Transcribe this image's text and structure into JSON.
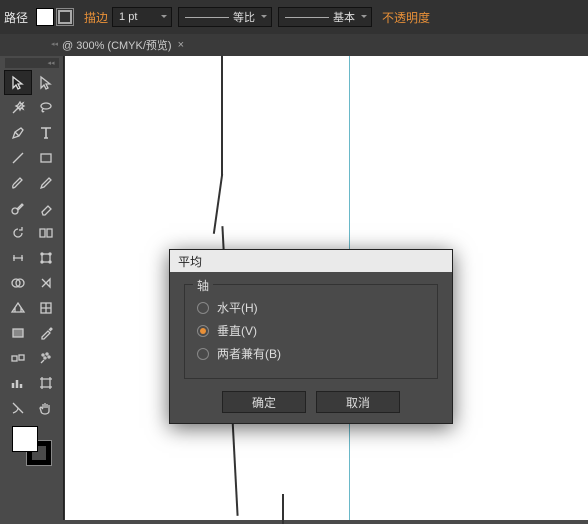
{
  "topbar": {
    "label": "路径",
    "stroke_label": "描边",
    "weight": "1 pt",
    "dash_label": "等比",
    "brush_label": "基本",
    "opacity_label": "不透明度"
  },
  "tab": {
    "title": "@ 300% (CMYK/预览)",
    "close": "×"
  },
  "dialog": {
    "title": "平均",
    "group_label": "轴",
    "options": {
      "h": "水平(H)",
      "v": "垂直(V)",
      "b": "两者兼有(B)"
    },
    "ok": "确定",
    "cancel": "取消"
  },
  "tools": {
    "selection": "selection",
    "direct": "direct-select",
    "wand": "magic-wand",
    "lasso": "lasso",
    "pen": "pen",
    "type": "type",
    "line": "line",
    "rect": "rectangle",
    "brush": "paintbrush",
    "pencil": "pencil",
    "blob": "blob-brush",
    "eraser": "eraser",
    "rotate": "rotate",
    "reflect": "reflect",
    "scale": "width",
    "warp": "free-transform",
    "shape": "shape-builder",
    "live": "live-paint",
    "persp": "perspective",
    "mesh": "mesh",
    "gradient": "gradient",
    "eyedrop": "eyedropper",
    "blend": "blend",
    "symbol": "symbol-spray",
    "graph": "column-graph",
    "artboard": "artboard",
    "slice": "slice",
    "hand": "hand"
  }
}
